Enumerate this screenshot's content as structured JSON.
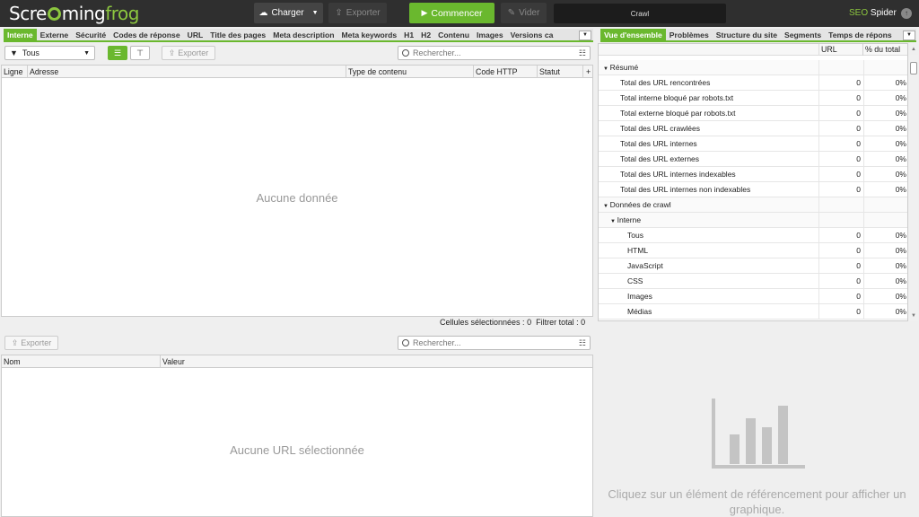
{
  "topbar": {
    "logo_pre": "Scre",
    "logo_post": "ming",
    "logo_frog": "frog",
    "load_label": "Charger",
    "export_label": "Exporter",
    "start_label": "Commencer",
    "clear_label": "Vider",
    "crawl_placeholder": "Crawl",
    "brand_seo": "SEO",
    "brand_spider": "Spider"
  },
  "left_tabs": [
    "Interne",
    "Externe",
    "Sécurité",
    "Codes de réponse",
    "URL",
    "Title des pages",
    "Meta description",
    "Meta keywords",
    "H1",
    "H2",
    "Contenu",
    "Images",
    "Versions ca"
  ],
  "right_tabs": [
    "Vue d'ensemble",
    "Problèmes",
    "Structure du site",
    "Segments",
    "Temps de répons"
  ],
  "toolbar": {
    "filter_value": "Tous",
    "export_label": "Exporter",
    "search_placeholder": "Rechercher..."
  },
  "main_table": {
    "columns": [
      "Ligne",
      "Adresse",
      "Type de contenu",
      "Code HTTP",
      "Statut"
    ],
    "empty_message": "Aucune donnée"
  },
  "status": {
    "selected_label": "Cellules sélectionnées :",
    "selected_value": "0",
    "filter_label": "Filtrer total :",
    "filter_value": "0"
  },
  "detail": {
    "export_label": "Exporter",
    "search_placeholder": "Rechercher...",
    "columns": [
      "Nom",
      "Valeur"
    ],
    "empty_message": "Aucune URL sélectionnée"
  },
  "overview": {
    "columns": [
      "URL",
      "% du total"
    ],
    "rows": [
      {
        "label": "Résumé",
        "level": 0,
        "section": true,
        "url": "",
        "pct": ""
      },
      {
        "label": "Total des URL rencontrées",
        "level": 2,
        "section": false,
        "url": "0",
        "pct": "0%"
      },
      {
        "label": "Total interne bloqué par robots.txt",
        "level": 2,
        "section": false,
        "url": "0",
        "pct": "0%"
      },
      {
        "label": "Total externe bloqué par robots.txt",
        "level": 2,
        "section": false,
        "url": "0",
        "pct": "0%"
      },
      {
        "label": "Total des URL crawlées",
        "level": 2,
        "section": false,
        "url": "0",
        "pct": "0%"
      },
      {
        "label": "Total des URL internes",
        "level": 2,
        "section": false,
        "url": "0",
        "pct": "0%"
      },
      {
        "label": "Total des URL externes",
        "level": 2,
        "section": false,
        "url": "0",
        "pct": "0%"
      },
      {
        "label": "Total des URL internes indexables",
        "level": 2,
        "section": false,
        "url": "0",
        "pct": "0%"
      },
      {
        "label": "Total des URL internes non indexables",
        "level": 2,
        "section": false,
        "url": "0",
        "pct": "0%"
      },
      {
        "label": "Données de crawl",
        "level": 0,
        "section": true,
        "url": "",
        "pct": ""
      },
      {
        "label": "Interne",
        "level": 1,
        "section": true,
        "url": "",
        "pct": ""
      },
      {
        "label": "Tous",
        "level": 3,
        "section": false,
        "url": "0",
        "pct": "0%"
      },
      {
        "label": "HTML",
        "level": 3,
        "section": false,
        "url": "0",
        "pct": "0%"
      },
      {
        "label": "JavaScript",
        "level": 3,
        "section": false,
        "url": "0",
        "pct": "0%"
      },
      {
        "label": "CSS",
        "level": 3,
        "section": false,
        "url": "0",
        "pct": "0%"
      },
      {
        "label": "Images",
        "level": 3,
        "section": false,
        "url": "0",
        "pct": "0%"
      },
      {
        "label": "Médias",
        "level": 3,
        "section": false,
        "url": "0",
        "pct": "0%"
      }
    ]
  },
  "chart_panel": {
    "message": "Cliquez sur un élément de référencement pour afficher un graphique."
  },
  "colors": {
    "accent": "#6ab82e",
    "topbar": "#2f2f2f"
  }
}
